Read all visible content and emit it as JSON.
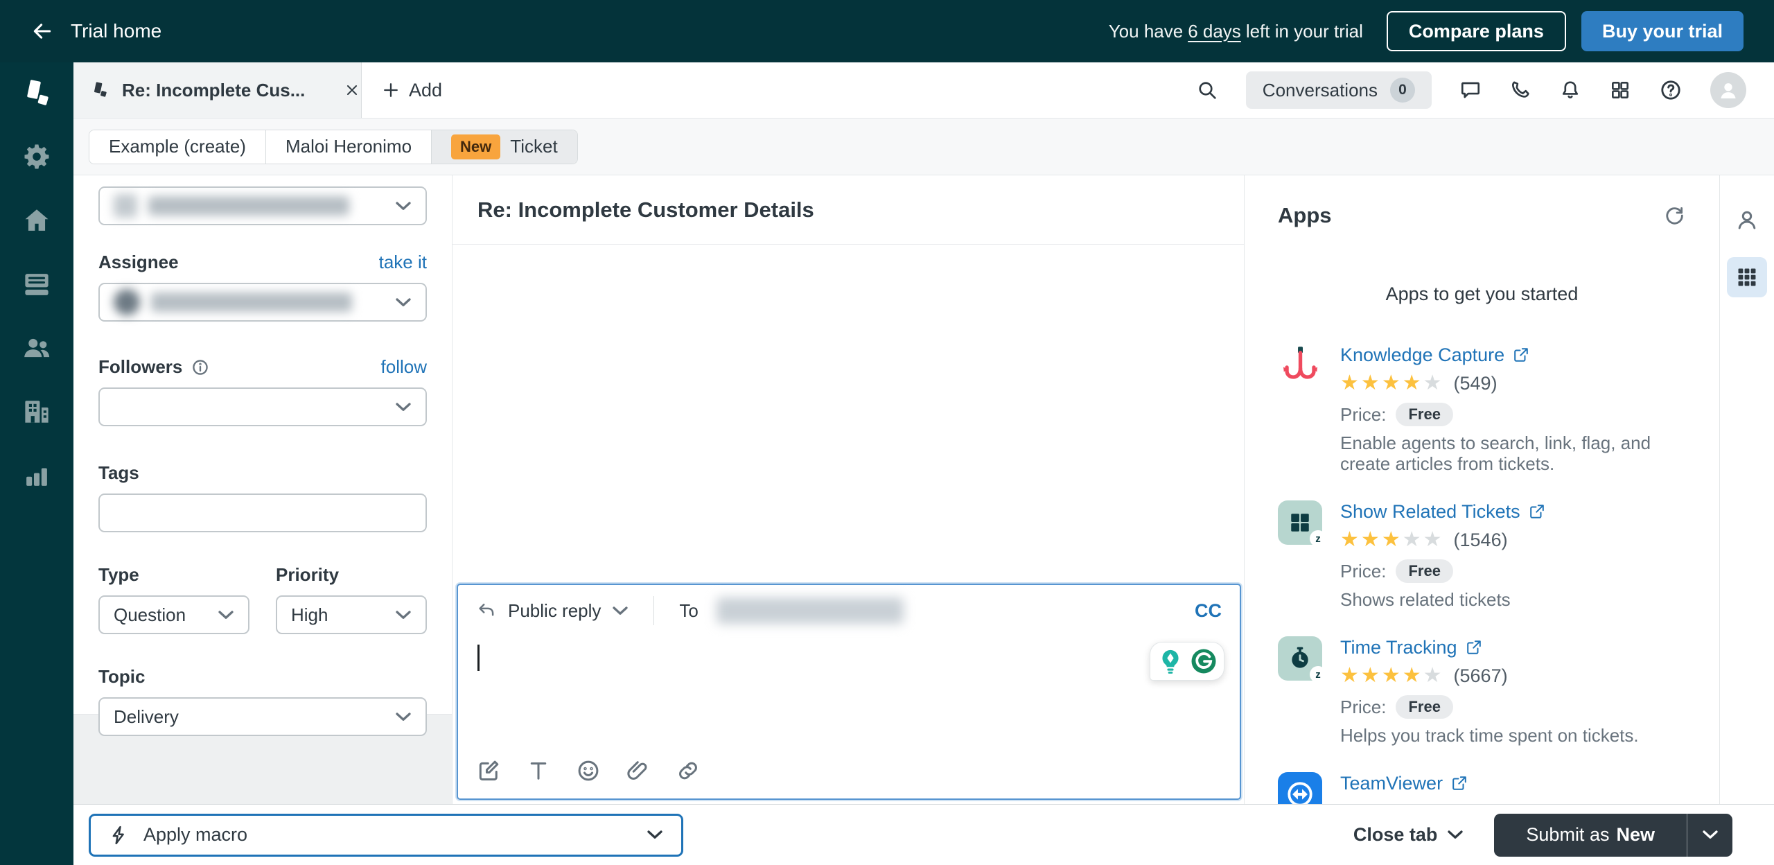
{
  "colors": {
    "brand_dark_teal": "#03363d",
    "accent_blue": "#1f73b7",
    "buy_button_blue": "#2e7dc1",
    "new_badge_orange": "#f8a43d",
    "star_yellow": "#fcc13e",
    "text_dark": "#2f3941",
    "text_gray": "#68737d"
  },
  "topbar": {
    "back_label": "Trial home",
    "trial_prefix": "You have",
    "trial_days": "6 days",
    "trial_suffix": "left in your trial",
    "compare_label": "Compare plans",
    "buy_label": "Buy your trial"
  },
  "tabstrip": {
    "active_tab_title": "Re: Incomplete Cus...",
    "add_label": "Add",
    "conversations_label": "Conversations",
    "conversations_count": "0"
  },
  "breadcrumb": {
    "workspace": "Example (create)",
    "requester": "Maloi Heronimo",
    "status_badge": "New",
    "object_label": "Ticket"
  },
  "ticket_form": {
    "assignee_label": "Assignee",
    "take_it_link": "take it",
    "followers_label": "Followers",
    "follow_link": "follow",
    "tags_label": "Tags",
    "type_label": "Type",
    "type_value": "Question",
    "priority_label": "Priority",
    "priority_value": "High",
    "topic_label": "Topic",
    "topic_value": "Delivery"
  },
  "ticket": {
    "subject": "Re: Incomplete Customer Details"
  },
  "composer": {
    "reply_type": "Public reply",
    "to_label": "To",
    "cc_label": "CC"
  },
  "apps_panel": {
    "title": "Apps",
    "subtitle": "Apps to get you started",
    "price_label": "Price:",
    "items": [
      {
        "name": "Knowledge Capture",
        "rating": 4,
        "reviews": "(549)",
        "price": "Free",
        "description": "Enable agents to search, link, flag, and create articles from tickets."
      },
      {
        "name": "Show Related Tickets",
        "rating": 3,
        "reviews": "(1546)",
        "price": "Free",
        "description": "Shows related tickets"
      },
      {
        "name": "Time Tracking",
        "rating": 4,
        "reviews": "(5667)",
        "price": "Free",
        "description": "Helps you track time spent on tickets."
      },
      {
        "name": "TeamViewer"
      }
    ]
  },
  "bottombar": {
    "apply_macro_label": "Apply macro",
    "close_tab_label": "Close tab",
    "submit_prefix": "Submit as",
    "submit_status": "New"
  },
  "icons": {
    "sidebar": [
      "zendesk-logo",
      "settings-gear",
      "home",
      "views-inbox",
      "customers-people",
      "organizations-building",
      "reporting-chart"
    ],
    "tabstrip": [
      "search",
      "message",
      "phone",
      "bell",
      "product-grid",
      "help",
      "avatar"
    ],
    "composer_toolbar": [
      "compose",
      "text-format",
      "emoji",
      "attachment",
      "link"
    ],
    "right_rail": [
      "user-profile",
      "apps-grid"
    ]
  }
}
